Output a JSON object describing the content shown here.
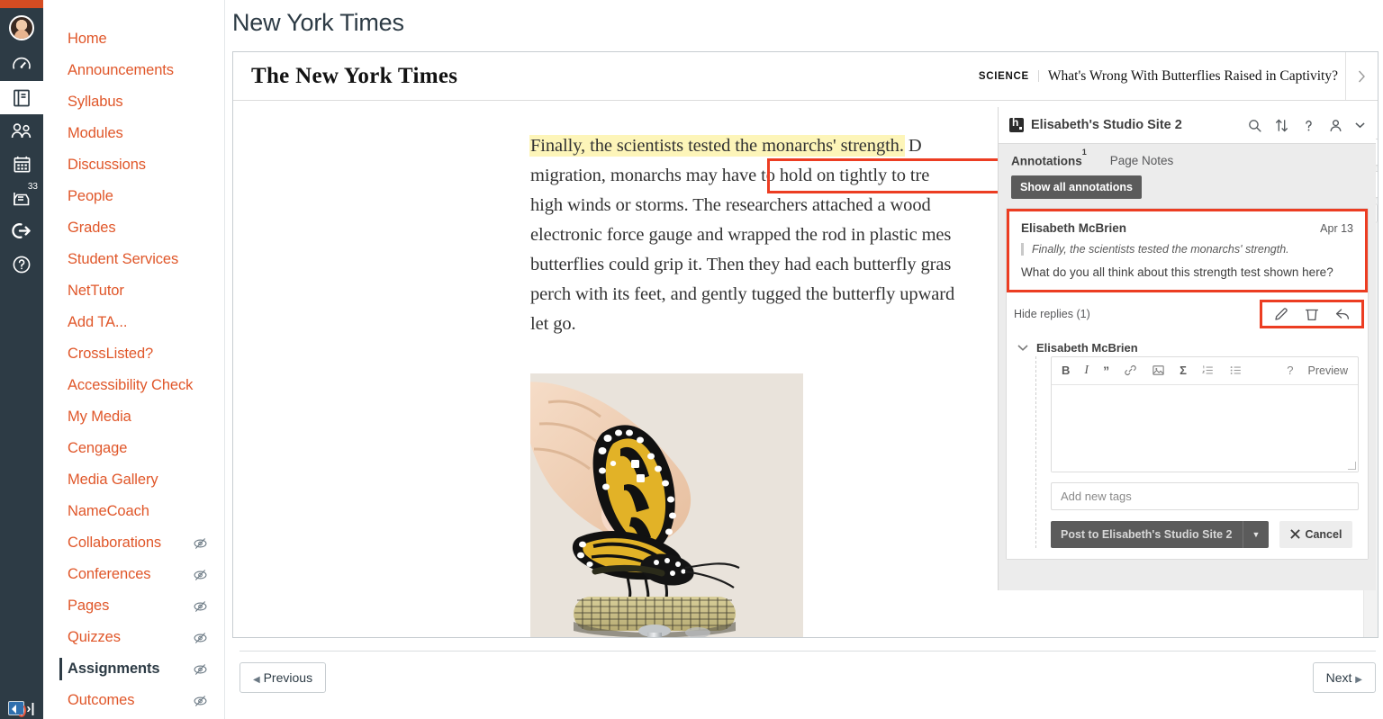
{
  "global_nav": {
    "accent_color": "#D64C22",
    "background": "#2D3B45",
    "items": [
      {
        "name": "account",
        "icon": "user-avatar-icon",
        "label": "Account"
      },
      {
        "name": "dashboard",
        "icon": "dashboard-gauge-icon",
        "label": "Dashboard"
      },
      {
        "name": "courses",
        "icon": "courses-book-icon",
        "label": "Courses",
        "active": true
      },
      {
        "name": "groups",
        "icon": "groups-people-icon",
        "label": "Groups"
      },
      {
        "name": "calendar",
        "icon": "calendar-icon",
        "label": "Calendar"
      },
      {
        "name": "inbox",
        "icon": "inbox-icon",
        "label": "Inbox",
        "badge": "33"
      },
      {
        "name": "logout",
        "icon": "logout-arrow-icon",
        "label": "Logout"
      },
      {
        "name": "help",
        "icon": "help-question-icon",
        "label": "Help"
      }
    ],
    "bottom": {
      "a11y_icon": "accessibility-speaker-icon",
      "collapse_icon": "collapse-nav-arrow-icon"
    }
  },
  "course_nav": {
    "link_color": "#E0572A",
    "items": [
      {
        "label": "Home",
        "hidden": false
      },
      {
        "label": "Announcements",
        "hidden": false
      },
      {
        "label": "Syllabus",
        "hidden": false
      },
      {
        "label": "Modules",
        "hidden": false
      },
      {
        "label": "Discussions",
        "hidden": false
      },
      {
        "label": "People",
        "hidden": false
      },
      {
        "label": "Grades",
        "hidden": false
      },
      {
        "label": "Student Services",
        "hidden": false
      },
      {
        "label": "NetTutor",
        "hidden": false
      },
      {
        "label": "Add TA...",
        "hidden": false
      },
      {
        "label": "CrossListed?",
        "hidden": false
      },
      {
        "label": "Accessibility Check",
        "hidden": false
      },
      {
        "label": "My Media",
        "hidden": false
      },
      {
        "label": "Cengage",
        "hidden": false
      },
      {
        "label": "Media Gallery",
        "hidden": false
      },
      {
        "label": "NameCoach",
        "hidden": false
      },
      {
        "label": "Collaborations",
        "hidden": true
      },
      {
        "label": "Conferences",
        "hidden": true
      },
      {
        "label": "Pages",
        "hidden": true
      },
      {
        "label": "Quizzes",
        "hidden": true
      },
      {
        "label": "Assignments",
        "hidden": true,
        "current": true
      },
      {
        "label": "Outcomes",
        "hidden": true
      }
    ]
  },
  "page": {
    "title": "New York Times"
  },
  "nyt": {
    "masthead": "The New York Times",
    "kicker": "SCIENCE",
    "headline": "What's Wrong With Butterflies Raised in Captivity?",
    "next_icon": "chevron-right-icon",
    "paragraph_highlight": "Finally, the scientists tested the monarchs' strength.",
    "paragraph_rest": " D                                         migration, monarchs may have to hold on tightly to tre             high winds or storms. The researchers attached a wood       electronic force gauge and wrapped the rod in plastic mes        butterflies could grip it. Then they had each butterfly gras        perch with its feet, and gently tugged the butterfly upward     let go.",
    "paragraph_lines": [
      "migration, monarchs may have to hold on tightly to tre",
      "high winds or storms. The researchers attached a wood",
      "electronic force gauge and wrapped the rod in plastic mes",
      "butterflies could grip it. Then they had each butterfly gras",
      "perch with its feet, and gently tugged the butterfly upward",
      "let go."
    ],
    "first_line_tail": " D",
    "image_alt": "Monarch butterfly held by a finger, perched on a mesh-wrapped rod",
    "tools": {
      "eye_icon": "eye-show-highlights-icon",
      "note_icon": "new-note-icon",
      "annotation_count": "1"
    }
  },
  "hypothesis": {
    "group_name": "Elisabeth's Studio Site 2",
    "logo_icon": "hypothesis-logo-icon",
    "top_icons": [
      {
        "name": "search-icon",
        "glyph": "search"
      },
      {
        "name": "sort-icon",
        "glyph": "sort"
      },
      {
        "name": "help-icon",
        "glyph": "question"
      },
      {
        "name": "account-icon",
        "glyph": "person"
      },
      {
        "name": "chevron-down-icon",
        "glyph": "chevron"
      }
    ],
    "tabs": [
      {
        "label": "Annotations",
        "count": "1",
        "active": true
      },
      {
        "label": "Page Notes",
        "count": "",
        "active": false
      }
    ],
    "show_all_label": "Show all annotations",
    "annotation": {
      "user": "Elisabeth McBrien",
      "date": "Apr 13",
      "quote": "Finally, the scientists tested the monarchs' strength.",
      "text": "What do you all think about this strength test shown here?",
      "hide_replies_label": "Hide replies (1)",
      "actions": [
        {
          "name": "edit-annotation-icon",
          "glyph": "pencil"
        },
        {
          "name": "delete-annotation-icon",
          "glyph": "trash"
        },
        {
          "name": "reply-annotation-icon",
          "glyph": "reply"
        }
      ]
    },
    "reply": {
      "user": "Elisabeth McBrien",
      "collapse_icon": "chevron-down-icon",
      "editor": {
        "toolbar": [
          {
            "name": "bold-icon",
            "label": "B"
          },
          {
            "name": "italic-icon",
            "label": "I"
          },
          {
            "name": "quote-icon",
            "label": "”"
          },
          {
            "name": "link-icon",
            "label": "link"
          },
          {
            "name": "image-icon",
            "label": "image"
          },
          {
            "name": "math-icon",
            "label": "Σ"
          },
          {
            "name": "numbered-list-icon",
            "label": "ol"
          },
          {
            "name": "bulleted-list-icon",
            "label": "ul"
          }
        ],
        "help_label": "?",
        "preview_label": "Preview",
        "body_value": ""
      },
      "tags_placeholder": "Add new tags",
      "post_label": "Post to Elisabeth's Studio Site 2",
      "post_caret_icon": "caret-down-icon",
      "cancel_label": "Cancel",
      "cancel_icon": "close-x-icon"
    },
    "highlight_box_color": "#EC3D22"
  },
  "pager": {
    "previous_label": "Previous",
    "next_label": "Next",
    "prev_icon": "chevron-left-icon",
    "next_icon": "chevron-right-icon"
  }
}
